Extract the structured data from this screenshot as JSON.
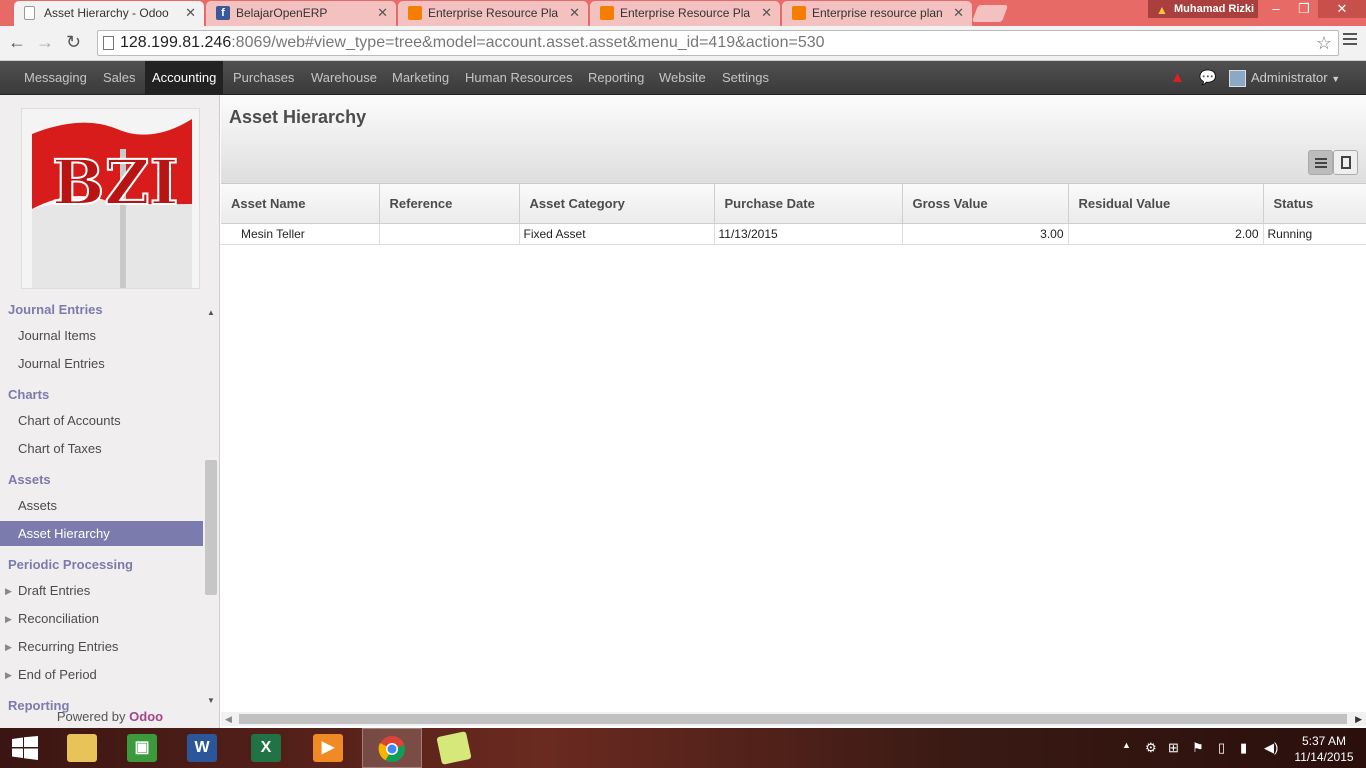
{
  "browser": {
    "tabs": [
      {
        "title": "Asset Hierarchy - Odoo",
        "icon": "page-icon",
        "active": true
      },
      {
        "title": "BelajarOpenERP",
        "icon": "facebook-icon",
        "active": false
      },
      {
        "title": "Enterprise Resource Plan",
        "icon": "blogger-icon",
        "active": false
      },
      {
        "title": "Enterprise Resource Plann",
        "icon": "blogger-icon",
        "active": false
      },
      {
        "title": "Enterprise resource planni",
        "icon": "blogger-icon",
        "active": false
      }
    ],
    "profile_name": "Muhamad Rizki",
    "url_host": "128.199.81.246",
    "url_rest": ":8069/web#view_type=tree&model=account.asset.asset&menu_id=419&action=530"
  },
  "topmenu": {
    "items": [
      "Messaging",
      "Sales",
      "Accounting",
      "Purchases",
      "Warehouse",
      "Marketing",
      "Human Resources",
      "Reporting",
      "Website",
      "Settings"
    ],
    "active": "Accounting",
    "user": "Administrator"
  },
  "sidebar": {
    "sections": [
      {
        "title": "Journal Entries",
        "items": [
          "Journal Items",
          "Journal Entries"
        ]
      },
      {
        "title": "Charts",
        "items": [
          "Chart of Accounts",
          "Chart of Taxes"
        ]
      },
      {
        "title": "Assets",
        "items": [
          "Assets",
          "Asset Hierarchy"
        ]
      },
      {
        "title": "Periodic Processing",
        "items": [
          "Draft Entries",
          "Reconciliation",
          "Recurring Entries",
          "End of Period"
        ]
      },
      {
        "title": "Reporting",
        "items": []
      }
    ],
    "active_item": "Asset Hierarchy",
    "powered_by": "Powered by",
    "powered_brand": "Odoo",
    "logo_text": "BZI"
  },
  "main": {
    "title": "Asset Hierarchy",
    "columns": [
      "Asset Name",
      "Reference",
      "Asset Category",
      "Purchase Date",
      "Gross Value",
      "Residual Value",
      "Status"
    ],
    "rows": [
      {
        "name": "Mesin Teller",
        "reference": "",
        "category": "Fixed Asset",
        "purchase_date": "11/13/2015",
        "gross": "3.00",
        "residual": "2.00",
        "status": "Running"
      }
    ]
  },
  "taskbar": {
    "apps": [
      "windows-start-icon",
      "file-explorer-icon",
      "store-icon",
      "word-icon",
      "excel-icon",
      "media-player-icon",
      "chrome-icon",
      "sticky-notes-icon"
    ],
    "time": "5:37 AM",
    "date": "11/14/2015"
  },
  "colors": {
    "tabstrip": "#e86a67",
    "odoo_menu": "#414141",
    "sidebar_accent": "#7c7bad",
    "brand": "#a24689"
  }
}
